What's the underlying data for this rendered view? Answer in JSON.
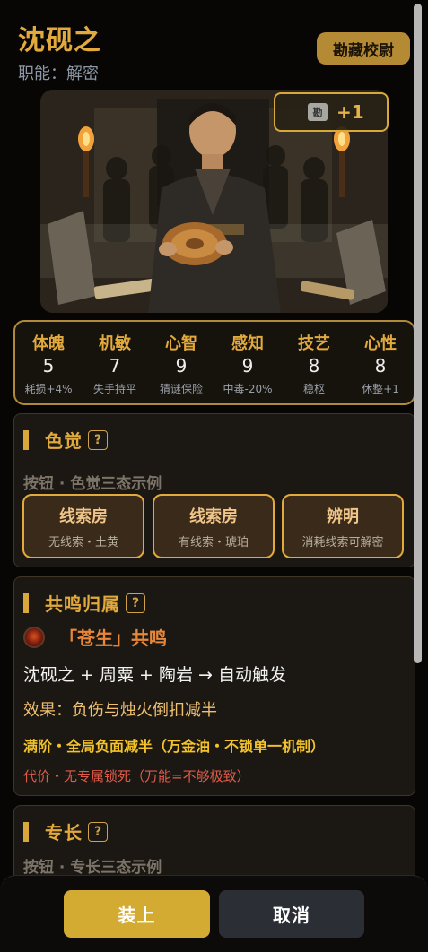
{
  "header": {
    "name": "沈砚之",
    "role": "职能：解密",
    "rank": "勘藏校尉"
  },
  "portrait": {
    "badge_icon": "scroll-icon",
    "badge_icon_glyph": "勘",
    "badge_text": "+1"
  },
  "stats": [
    {
      "label": "体魄",
      "value": "5",
      "note": "耗损+4%"
    },
    {
      "label": "机敏",
      "value": "7",
      "note": "失手持平"
    },
    {
      "label": "心智",
      "value": "9",
      "note": "猜谜保险"
    },
    {
      "label": "感知",
      "value": "9",
      "note": "中毒-20%"
    },
    {
      "label": "技艺",
      "value": "8",
      "note": "稳枢"
    },
    {
      "label": "心性",
      "value": "8",
      "note": "休整+1"
    }
  ],
  "color_sense": {
    "title": "色觉",
    "help": "?",
    "subhead": "按钮 · 色觉三态示例",
    "options": [
      {
        "main": "线索房",
        "sub": "无线索・土黄"
      },
      {
        "main": "线索房",
        "sub": "有线索・琥珀"
      },
      {
        "main": "辨明",
        "sub": "消耗线索可解密"
      }
    ]
  },
  "resonance": {
    "title": "共鸣归属",
    "help": "?",
    "name": "「苍生」共鸣",
    "members": "沈砚之 + 周粟 + 陶岩 → 自动触发",
    "effect": "效果：负伤与烛火倒扣减半",
    "maxed": "满阶・全局负面减半（万金油・不锁单一机制）",
    "cost": "代价・无专属锁死（万能=不够极致）"
  },
  "specialty": {
    "title": "专长",
    "help": "?",
    "subhead": "按钮 · 专长三态示例"
  },
  "actions": {
    "equip": "装上",
    "cancel": "取消"
  },
  "colors": {
    "accent": "#e2a93c",
    "equip": "#d3ab33",
    "danger": "#e05a4a",
    "resonance": "#e8873a"
  }
}
